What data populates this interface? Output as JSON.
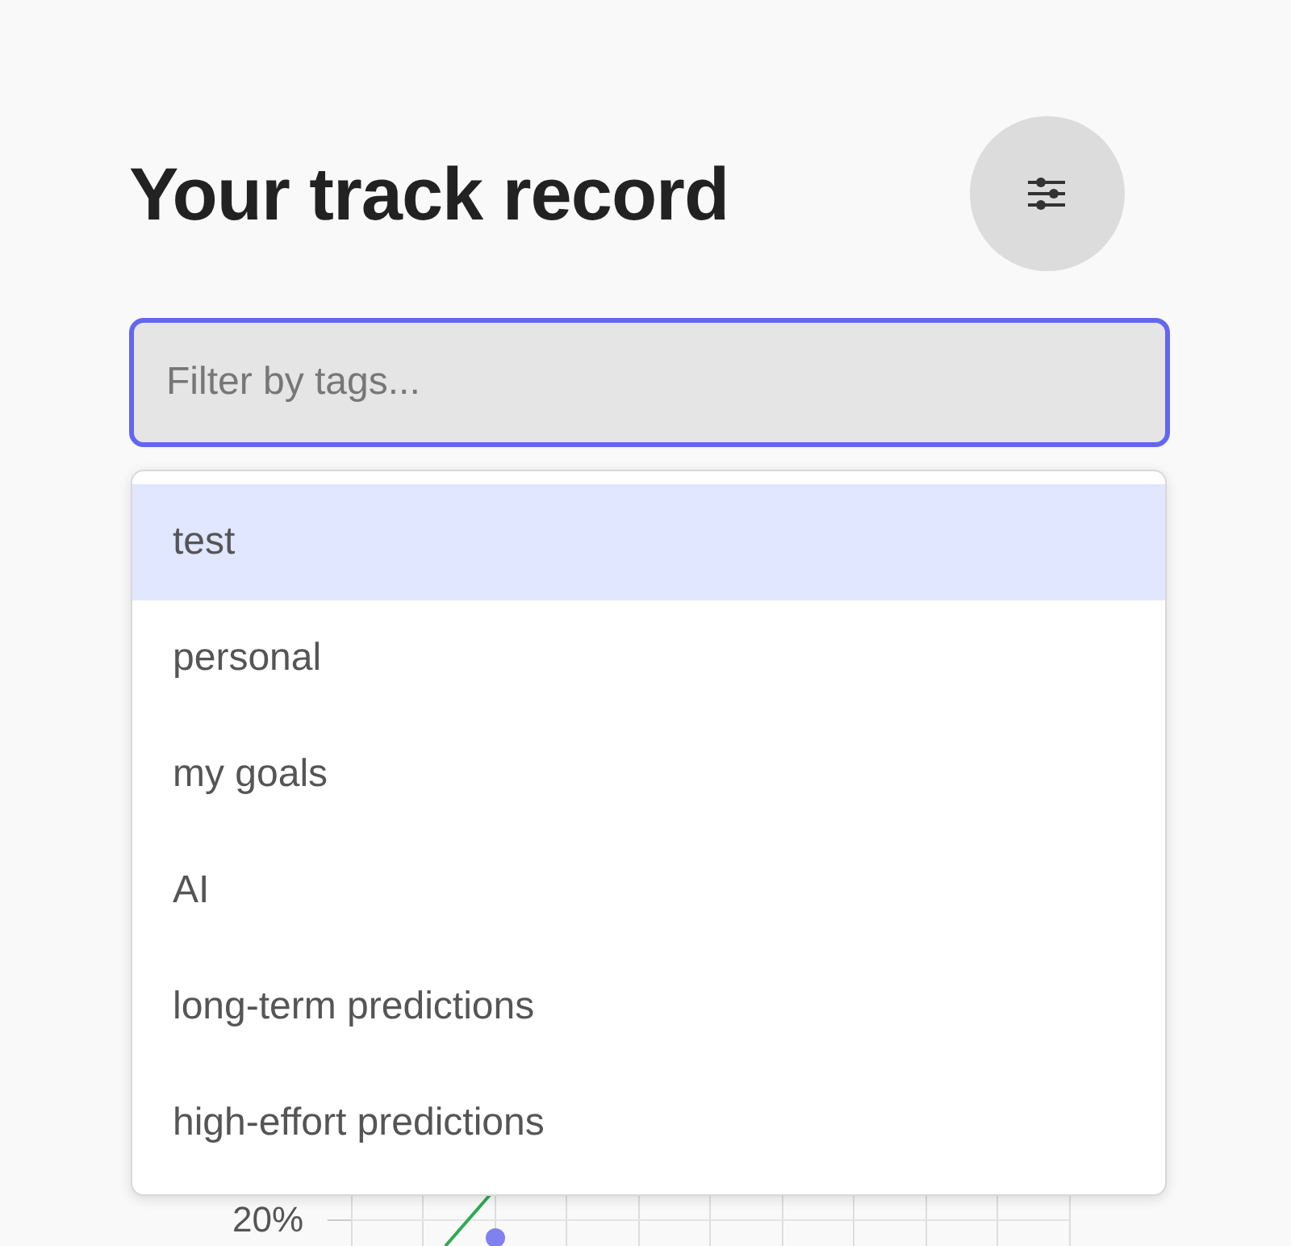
{
  "title": "Your track record",
  "filter": {
    "placeholder": "Filter by tags..."
  },
  "tag_options": [
    {
      "label": "test",
      "selected": true
    },
    {
      "label": "personal",
      "selected": false
    },
    {
      "label": "my goals",
      "selected": false
    },
    {
      "label": "AI",
      "selected": false
    },
    {
      "label": "long-term predictions",
      "selected": false
    },
    {
      "label": "high-effort predictions",
      "selected": false
    }
  ],
  "chart": {
    "y_tick": "20%"
  }
}
